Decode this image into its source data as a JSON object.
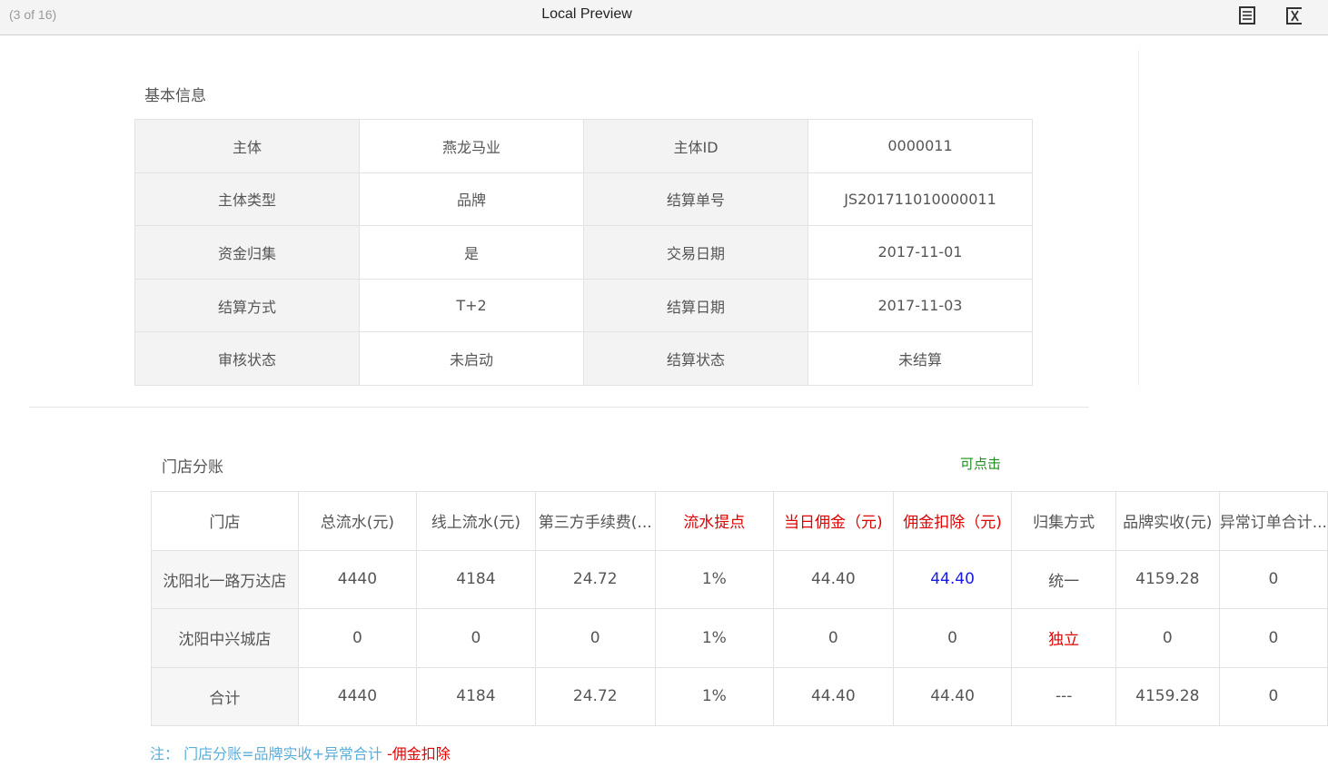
{
  "topbar": {
    "counter": "(3 of 16)",
    "title": "Local Preview",
    "icons": [
      "list-icon",
      "close-formula-icon"
    ]
  },
  "basic_info": {
    "section_title": "基本信息",
    "rows": [
      {
        "label1": "主体",
        "value1": "燕龙马业",
        "label2": "主体ID",
        "value2": "0000011"
      },
      {
        "label1": "主体类型",
        "value1": "品牌",
        "label2": "结算单号",
        "value2": "JS201711010000011"
      },
      {
        "label1": "资金归集",
        "value1": "是",
        "label2": "交易日期",
        "value2": "2017-11-01"
      },
      {
        "label1": "结算方式",
        "value1": "T+2",
        "label2": "结算日期",
        "value2": "2017-11-03"
      },
      {
        "label1": "审核状态",
        "value1": "未启动",
        "label2": "结算状态",
        "value2": "未结算"
      }
    ]
  },
  "store_split": {
    "section_title": "门店分账",
    "clickable_note": "可点击",
    "headers": [
      "门店",
      "总流水(元)",
      "线上流水(元)",
      "第三方手续费(...",
      "流水提点",
      "当日佣金（元)",
      "佣金扣除（元)",
      "归集方式",
      "品牌实收(元)",
      "异常订单合计..."
    ],
    "rows": [
      [
        "沈阳北一路万达店",
        "4440",
        "4184",
        "24.72",
        "1%",
        "44.40",
        "44.40",
        "统一",
        "4159.28",
        "0"
      ],
      [
        "沈阳中兴城店",
        "0",
        "0",
        "0",
        "1%",
        "0",
        "0",
        "独立",
        "0",
        "0"
      ],
      [
        "合计",
        "4440",
        "4184",
        "24.72",
        "1%",
        "44.40",
        "44.40",
        "---",
        "4159.28",
        "0"
      ]
    ],
    "colors": {
      "highlight_red": "#e00000",
      "link_blue": "#1a1ae6",
      "note_green": "#1e8f1e"
    }
  },
  "footnote": {
    "main": "注： 门店分账=品牌实收+异常合计",
    "red": " -佣金扣除"
  }
}
